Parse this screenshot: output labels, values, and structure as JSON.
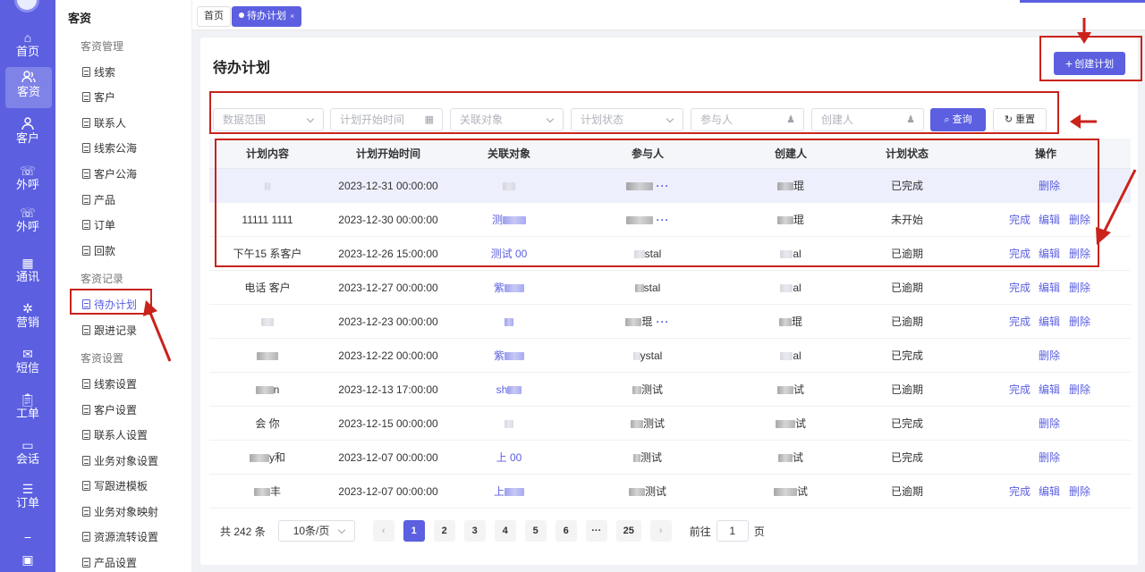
{
  "rail": {
    "items": [
      {
        "label": "首页",
        "icon": "home-icon"
      },
      {
        "label": "客资",
        "icon": "users-icon"
      },
      {
        "label": "客户",
        "icon": "user-icon"
      },
      {
        "label": "外呼",
        "icon": "phone-out-icon"
      },
      {
        "label": "外呼",
        "icon": "phone-call-icon"
      },
      {
        "label": "通讯",
        "icon": "address-book-icon"
      },
      {
        "label": "营销",
        "icon": "marketing-icon"
      },
      {
        "label": "短信",
        "icon": "sms-icon"
      },
      {
        "label": "工单",
        "icon": "clipboard-icon"
      },
      {
        "label": "会话",
        "icon": "chat-icon"
      },
      {
        "label": "订单",
        "icon": "order-icon"
      }
    ]
  },
  "menu": {
    "title": "客资",
    "groups": [
      {
        "label": "客资管理",
        "items": [
          "线索",
          "客户",
          "联系人",
          "线索公海",
          "客户公海",
          "产品",
          "订单",
          "回款"
        ]
      },
      {
        "label": "客资记录",
        "items": [
          "待办计划",
          "跟进记录"
        ]
      },
      {
        "label": "客资设置",
        "items": [
          "线索设置",
          "客户设置",
          "联系人设置",
          "业务对象设置",
          "写跟进模板",
          "业务对象映射",
          "资源流转设置",
          "产品设置"
        ]
      }
    ],
    "active": "待办计划"
  },
  "tabs": [
    {
      "label": "首页"
    },
    {
      "label": "待办计划",
      "close": "×"
    }
  ],
  "page": {
    "title": "待办计划",
    "create_label": "创建计划"
  },
  "filters": {
    "range_placeholder": "数据范围",
    "start_placeholder": "计划开始时间",
    "object_placeholder": "关联对象",
    "status_placeholder": "计划状态",
    "participant_placeholder": "参与人",
    "creator_placeholder": "创建人",
    "query_label": "查询",
    "reset_label": "重置"
  },
  "table": {
    "headers": [
      "计划内容",
      "计划开始时间",
      "关联对象",
      "参与人",
      "创建人",
      "计划状态",
      "操作"
    ],
    "op_labels": {
      "complete": "完成",
      "edit": "编辑",
      "delete": "删除"
    },
    "rows": [
      {
        "content": "",
        "start": "2023-12-31 00:00:00",
        "object": "",
        "participant": "",
        "creator": "琨",
        "status": "已完成",
        "ops": [
          "删除"
        ]
      },
      {
        "content": "11111 1111",
        "start": "2023-12-30 00:00:00",
        "object": "测",
        "participant": "",
        "creator": "琨",
        "status": "未开始",
        "ops": [
          "完成",
          "编辑",
          "删除"
        ]
      },
      {
        "content": "下午15 系客户",
        "start": "2023-12-26 15:00:00",
        "object": "测试 00",
        "participant": "stal",
        "creator": "al",
        "status": "已逾期",
        "ops": [
          "完成",
          "编辑",
          "删除"
        ]
      },
      {
        "content": "电话 客户",
        "start": "2023-12-27 00:00:00",
        "object": "紫",
        "participant": "stal",
        "creator": "al",
        "status": "已逾期",
        "ops": [
          "完成",
          "编辑",
          "删除"
        ]
      },
      {
        "content": "",
        "start": "2023-12-23 00:00:00",
        "object": "",
        "participant": "琨",
        "creator": "琨",
        "status": "已逾期",
        "ops": [
          "完成",
          "编辑",
          "删除"
        ]
      },
      {
        "content": "",
        "start": "2023-12-22 00:00:00",
        "object": "紫",
        "participant": "ystal",
        "creator": "al",
        "status": "已完成",
        "ops": [
          "删除"
        ]
      },
      {
        "content": "n",
        "start": "2023-12-13 17:00:00",
        "object": "sh",
        "participant": "测试",
        "creator": "试",
        "status": "已逾期",
        "ops": [
          "完成",
          "编辑",
          "删除"
        ]
      },
      {
        "content": "会 你",
        "start": "2023-12-15 00:00:00",
        "object": "",
        "participant": "测试",
        "creator": "试",
        "status": "已完成",
        "ops": [
          "删除"
        ]
      },
      {
        "content": "y和",
        "start": "2023-12-07 00:00:00",
        "object": "上 00",
        "participant": "测试",
        "creator": "试",
        "status": "已完成",
        "ops": [
          "删除"
        ]
      },
      {
        "content": "丰",
        "start": "2023-12-07 00:00:00",
        "object": "上",
        "participant": "测试",
        "creator": "试",
        "status": "已逾期",
        "ops": [
          "完成",
          "编辑",
          "删除"
        ]
      }
    ]
  },
  "pagination": {
    "total_label": "共 242 条",
    "page_size": "10条/页",
    "pages": [
      "1",
      "2",
      "3",
      "4",
      "5",
      "6",
      "···",
      "25"
    ],
    "current": "1",
    "goto_label": "前往",
    "goto_value": "1",
    "goto_suffix": "页"
  },
  "colors": {
    "accent": "#5b5fe0",
    "annotation": "#c9231c"
  }
}
